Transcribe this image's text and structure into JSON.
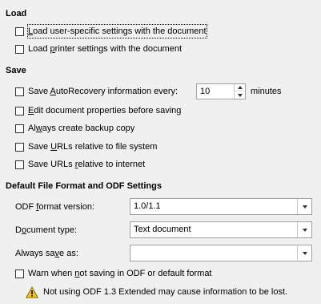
{
  "load": {
    "title": "Load",
    "user_settings": {
      "pre": "",
      "key": "L",
      "post": "oad user-specific settings with the document",
      "checked": false
    },
    "printer_settings": {
      "pre": "Load ",
      "key": "p",
      "post": "rinter settings with the document",
      "checked": false
    }
  },
  "save": {
    "title": "Save",
    "autorecovery": {
      "pre": "Save ",
      "key": "A",
      "post": "utoRecovery information every:",
      "checked": false
    },
    "autorecovery_value": "10",
    "minutes_label": "minutes",
    "edit_props": {
      "pre": "",
      "key": "E",
      "post": "dit document properties before saving",
      "checked": false
    },
    "backup": {
      "pre": "Al",
      "key": "w",
      "post": "ays create backup copy",
      "checked": false
    },
    "urls_fs": {
      "pre": "Save ",
      "key": "U",
      "post": "RLs relative to file system",
      "checked": false
    },
    "urls_inet": {
      "pre": "Save URLs ",
      "key": "r",
      "post": "elative to internet",
      "checked": false
    }
  },
  "format": {
    "title": "Default File Format and ODF Settings",
    "odf_version_label": {
      "pre": "ODF ",
      "key": "f",
      "post": "ormat version:"
    },
    "odf_version_value": "1.0/1.1",
    "doc_type_label": {
      "pre": "D",
      "key": "o",
      "post": "cument type:"
    },
    "doc_type_value": "Text document",
    "always_save_label": {
      "pre": "Always sa",
      "key": "v",
      "post": "e as:"
    },
    "always_save_value": "",
    "warn": {
      "pre": "Warn when ",
      "key": "n",
      "post": "ot saving in ODF or default format",
      "checked": false
    },
    "warning_text": "Not using ODF 1.3 Extended may cause information to be lost."
  },
  "colors": {
    "background": "#f0f0f0",
    "warning_icon": "#f5c518"
  }
}
